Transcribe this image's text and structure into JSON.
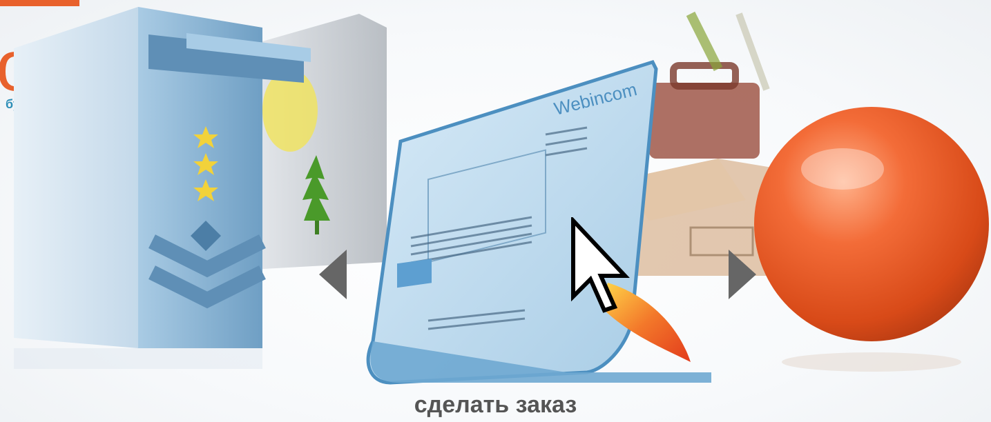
{
  "logo": {
    "text": "om",
    "tagline": "будущее"
  },
  "carousel": {
    "caption": "сделать заказ",
    "prev_icon": "chevron-left-icon",
    "next_icon": "chevron-right-icon",
    "slides": [
      {
        "name": "server",
        "icon": "server-tower-icon"
      },
      {
        "name": "box",
        "icon": "cardboard-box-icon"
      },
      {
        "name": "order-form",
        "icon": "webpage-mockup-icon",
        "brand": "Webincom"
      },
      {
        "name": "sphere",
        "icon": "orange-sphere-icon"
      }
    ]
  },
  "colors": {
    "accent": "#e8612c",
    "tagline": "#2e8fb8",
    "server_blue": "#8fb8d8",
    "caption": "#555555",
    "arrow": "#666666"
  }
}
